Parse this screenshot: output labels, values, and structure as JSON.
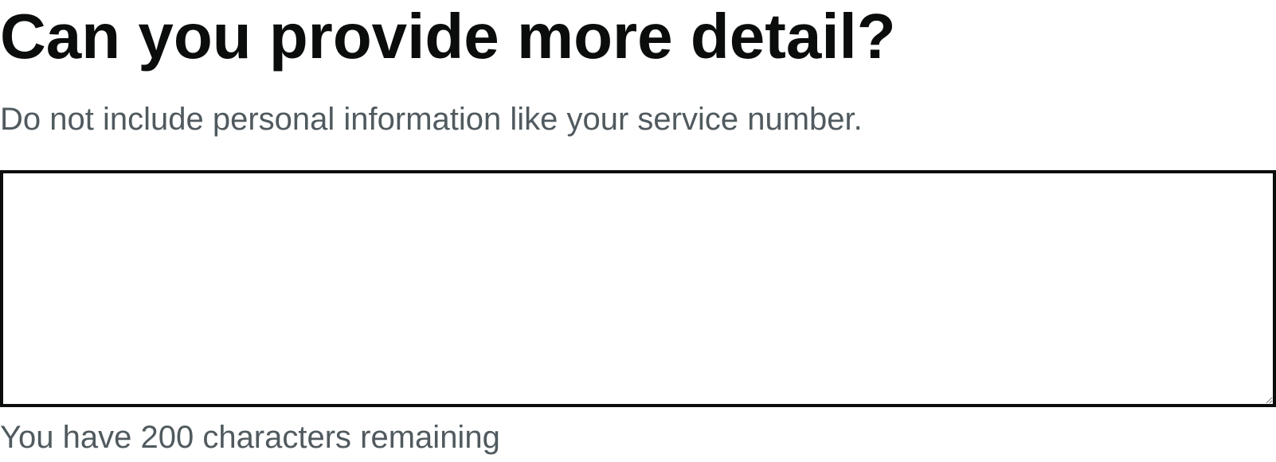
{
  "question": {
    "heading": "Can you provide more detail?",
    "hint": "Do not include personal information like your service number."
  },
  "detail_field": {
    "value": "",
    "max_characters": 200
  },
  "character_count": {
    "message": "You have 200 characters remaining"
  },
  "colors": {
    "text": "#0b0c0c",
    "secondary_text": "#505a5f",
    "border": "#0b0c0c",
    "background": "#ffffff"
  }
}
